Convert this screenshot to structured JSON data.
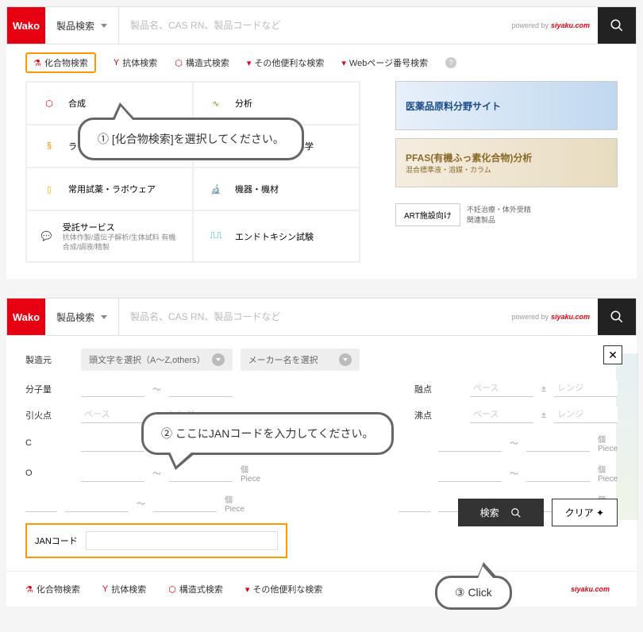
{
  "logo": "Wako",
  "searchSelect": "製品検索",
  "searchPlaceholder": "製品名、CAS RN、製品コードなど",
  "poweredBy": "powered by",
  "poweredBrand": "siyaku.com",
  "tabs": {
    "compound": "化合物検索",
    "antibody": "抗体検索",
    "structure": "構造式検索",
    "other": "その他便利な検索",
    "webpage": "Webページ番号検索"
  },
  "cats": {
    "gousei": "合成",
    "bunseki": "分析",
    "life": "ライフサイエンス",
    "souchi": "装置診断・細胞科学",
    "shiyaku": "常用試薬・ラボウェア",
    "kiki": "機器・機材",
    "jutaku": "受託サービス",
    "jutakuSub": "抗体作製/遺伝子解析/生体試料\n有機合成/調液/精製",
    "endo": "エンドトキシン試験"
  },
  "banners": {
    "b1": "医薬品原料分野サイト",
    "b2": "PFAS(有機ふっ素化合物)分析",
    "b2sub": "混合標準液・溶媒・カラム",
    "art": "ART施設向け",
    "artSide": "不妊治療・体外受精\n関連製品"
  },
  "callouts": {
    "c1": "① [化合物検索]を選択してください。",
    "c2": "② ここにJANコードを入力してください。",
    "c3": "③ Click"
  },
  "form": {
    "maker": "製造元",
    "makerSel1": "頭文字を選択（A～Z,others）",
    "makerSel2": "メーカー名を選択",
    "mw": "分子量",
    "flash": "引火点",
    "mp": "融点",
    "bp": "沸点",
    "base": "ベース",
    "range": "レンジ",
    "pm": "±",
    "tilde": "～",
    "c": "C",
    "o": "O",
    "piece": "個\nPiece",
    "jan": "JANコード",
    "search": "検索",
    "clear": "クリア ✦"
  }
}
